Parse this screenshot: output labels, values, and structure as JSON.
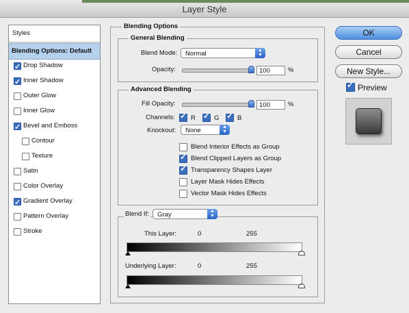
{
  "window": {
    "title": "Layer Style"
  },
  "sidebar": {
    "header": "Styles",
    "items": [
      {
        "label": "Blending Options: Default",
        "type": "header",
        "checked": null,
        "selected": true
      },
      {
        "label": "Drop Shadow",
        "checked": true
      },
      {
        "label": "Inner Shadow",
        "checked": true
      },
      {
        "label": "Outer Glow",
        "checked": false
      },
      {
        "label": "Inner Glow",
        "checked": false
      },
      {
        "label": "Bevel and Emboss",
        "checked": true
      },
      {
        "label": "Contour",
        "checked": false,
        "sub": true
      },
      {
        "label": "Texture",
        "checked": false,
        "sub": true
      },
      {
        "label": "Satin",
        "checked": false
      },
      {
        "label": "Color Overlay",
        "checked": false
      },
      {
        "label": "Gradient Overlay",
        "checked": true
      },
      {
        "label": "Pattern Overlay",
        "checked": false
      },
      {
        "label": "Stroke",
        "checked": false
      }
    ]
  },
  "blending_options": {
    "title": "Blending Options",
    "general": {
      "title": "General Blending",
      "blend_mode_label": "Blend Mode:",
      "blend_mode_value": "Normal",
      "opacity_label": "Opacity:",
      "opacity_value": "100",
      "opacity_unit": "%"
    },
    "advanced": {
      "title": "Advanced Blending",
      "fill_opacity_label": "Fill Opacity:",
      "fill_opacity_value": "100",
      "fill_opacity_unit": "%",
      "channels_label": "Channels:",
      "channels": [
        {
          "label": "R",
          "checked": true
        },
        {
          "label": "G",
          "checked": true
        },
        {
          "label": "B",
          "checked": true
        }
      ],
      "knockout_label": "Knockout:",
      "knockout_value": "None",
      "options": [
        {
          "label": "Blend Interior Effects as Group",
          "checked": false
        },
        {
          "label": "Blend Clipped Layers as Group",
          "checked": true
        },
        {
          "label": "Transparency Shapes Layer",
          "checked": true
        },
        {
          "label": "Layer Mask Hides Effects",
          "checked": false
        },
        {
          "label": "Vector Mask Hides Effects",
          "checked": false
        }
      ]
    },
    "blend_if": {
      "label": "Blend If:",
      "value": "Gray",
      "this_layer_label": "This Layer:",
      "this_layer_min": "0",
      "this_layer_max": "255",
      "underlying_label": "Underlying Layer:",
      "underlying_min": "0",
      "underlying_max": "255"
    }
  },
  "buttons": {
    "ok": "OK",
    "cancel": "Cancel",
    "new_style": "New Style...",
    "preview_label": "Preview",
    "preview_checked": true
  },
  "colors": {
    "accent": "#3a6fbf",
    "selection": "#b5d1ee"
  }
}
